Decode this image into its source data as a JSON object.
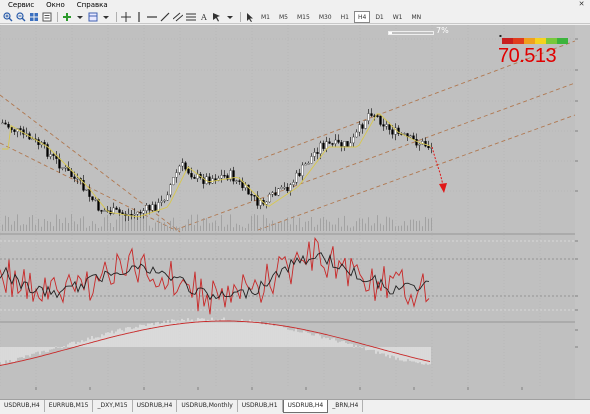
{
  "menu": {
    "items": [
      "Сервис",
      "Окно",
      "Справка"
    ]
  },
  "toolbar": {
    "timeframes": [
      "M1",
      "M5",
      "M15",
      "M30",
      "H1",
      "H4",
      "D1",
      "W1",
      "MN"
    ],
    "active_timeframe": "H4"
  },
  "one_click": {
    "percent_label": "7%",
    "fill": 0.07
  },
  "price_widget": {
    "price": "70.513",
    "colors": [
      "#c81e1e",
      "#e03c1e",
      "#f0a01e",
      "#f5d21e",
      "#78c83c",
      "#3cb43c"
    ]
  },
  "tabs": [
    "USDRUB,H4",
    "EURRUB,M15",
    "_DXY,M15",
    "USDRUB,H4",
    "USDRUB,Monthly",
    "USDRUB,H1",
    "USDRUB,H4",
    "_BRN,H4"
  ],
  "active_tab_index": 6,
  "chart_data": {
    "type": "candlestick",
    "symbol": "USDRUB,H4",
    "last_price": 70.513,
    "indicators": [
      "moving average",
      "two oscillator lines",
      "MACD-style histogram with signal line"
    ],
    "channels": 2,
    "projection": "downward dashed red arrow after last bar"
  }
}
